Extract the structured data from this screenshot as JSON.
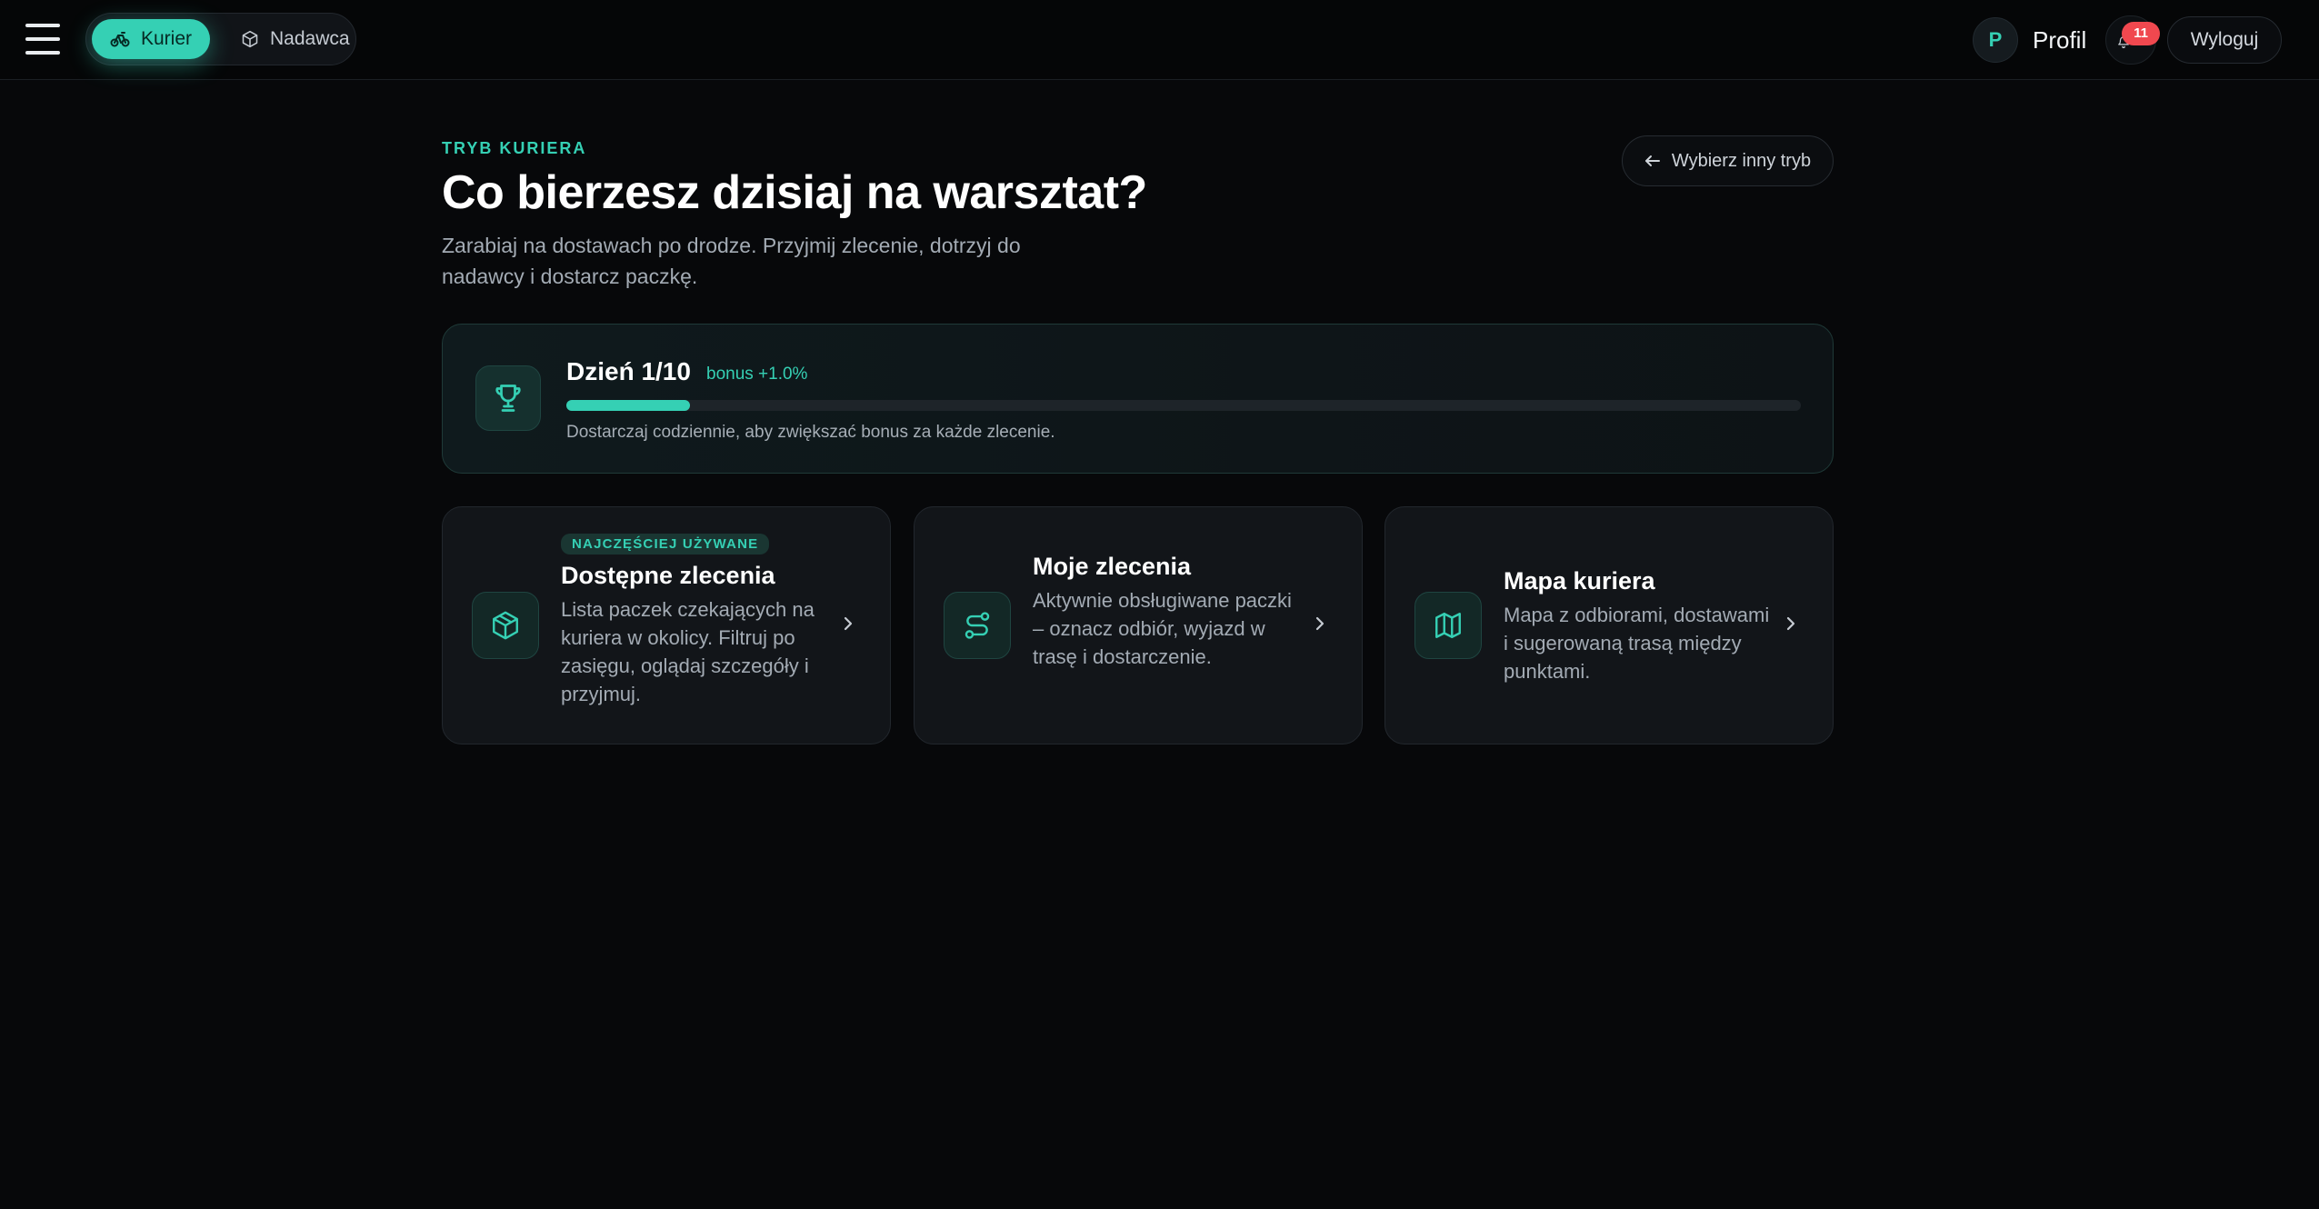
{
  "colors": {
    "accent": "#35d0b4",
    "background": "#07080a",
    "card": "#121519",
    "badge": "#f0484f"
  },
  "topbar": {
    "menu_icon": "hamburger-icon",
    "modes": [
      {
        "label": "Kurier",
        "icon": "bike-icon",
        "active": true
      },
      {
        "label": "Nadawca",
        "icon": "package-icon",
        "active": false
      }
    ],
    "profile": {
      "avatar_letter": "P",
      "label": "Profil"
    },
    "notifications": {
      "icon": "bell-icon",
      "count": "11"
    },
    "logout_label": "Wyloguj"
  },
  "hero": {
    "eyebrow": "TRYB KURIERA",
    "title": "Co bierzesz dzisiaj na warsztat?",
    "subtitle": "Zarabiaj na dostawach po drodze. Przyjmij zlecenie, dotrzyj do nadawcy i dostarcz paczkę.",
    "back_button_label": "Wybierz inny tryb"
  },
  "streak": {
    "icon": "trophy-icon",
    "day_label": "Dzień 1/10",
    "bonus_label": "bonus +1.0%",
    "progress_fraction": 0.1,
    "hint": "Dostarczaj codziennie, aby zwiększać bonus za każde zlecenie."
  },
  "cards": [
    {
      "icon": "package-icon",
      "tag": "NAJCZĘŚCIEJ UŻYWANE",
      "title": "Dostępne zlecenia",
      "description": "Lista paczek czekających na kuriera w okolicy. Filtruj po zasięgu, oglądaj szczegóły i przyjmuj."
    },
    {
      "icon": "route-icon",
      "tag": "",
      "title": "Moje zlecenia",
      "description": "Aktywnie obsługiwane paczki – oznacz odbiór, wyjazd w trasę i dostarczenie."
    },
    {
      "icon": "map-icon",
      "tag": "",
      "title": "Mapa kuriera",
      "description": "Mapa z odbiorami, dostawami i sugerowaną trasą między punktami."
    }
  ]
}
